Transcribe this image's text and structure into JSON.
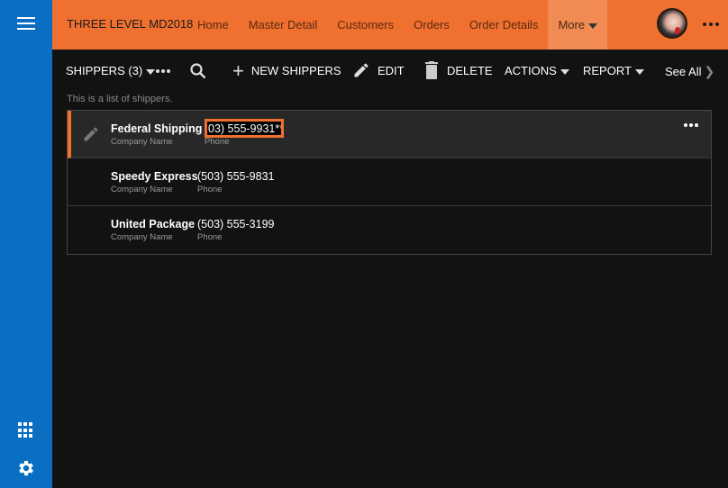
{
  "sidebar": {
    "menu_icon": "hamburger-icon",
    "apps_icon": "apps-grid-icon",
    "settings_icon": "gear-icon"
  },
  "header": {
    "app_title": "THREE LEVEL MD2018",
    "nav": [
      {
        "label": "Home"
      },
      {
        "label": "Master Detail"
      },
      {
        "label": "Customers"
      },
      {
        "label": "Orders"
      },
      {
        "label": "Order Details"
      },
      {
        "label": "More"
      }
    ],
    "colors": {
      "bar": "#f07030",
      "sidebar": "#0a6ec2"
    }
  },
  "toolbar": {
    "view_label": "SHIPPERS (3)",
    "new_label": "NEW SHIPPERS",
    "edit_label": "EDIT",
    "delete_label": "DELETE",
    "actions_label": "ACTIONS",
    "report_label": "REPORT",
    "see_all_label": "See All"
  },
  "description": "This is a list of shippers.",
  "list": {
    "rows": [
      {
        "company": "Federal Shipping",
        "company_label": "Company Name",
        "phone": "03) 555-9931**",
        "phone_label": "Phone"
      },
      {
        "company": "Speedy Express",
        "company_label": "Company Name",
        "phone": "(503) 555-9831",
        "phone_label": "Phone"
      },
      {
        "company": "United Package",
        "company_label": "Company Name",
        "phone": "(503) 555-3199",
        "phone_label": "Phone"
      }
    ]
  }
}
